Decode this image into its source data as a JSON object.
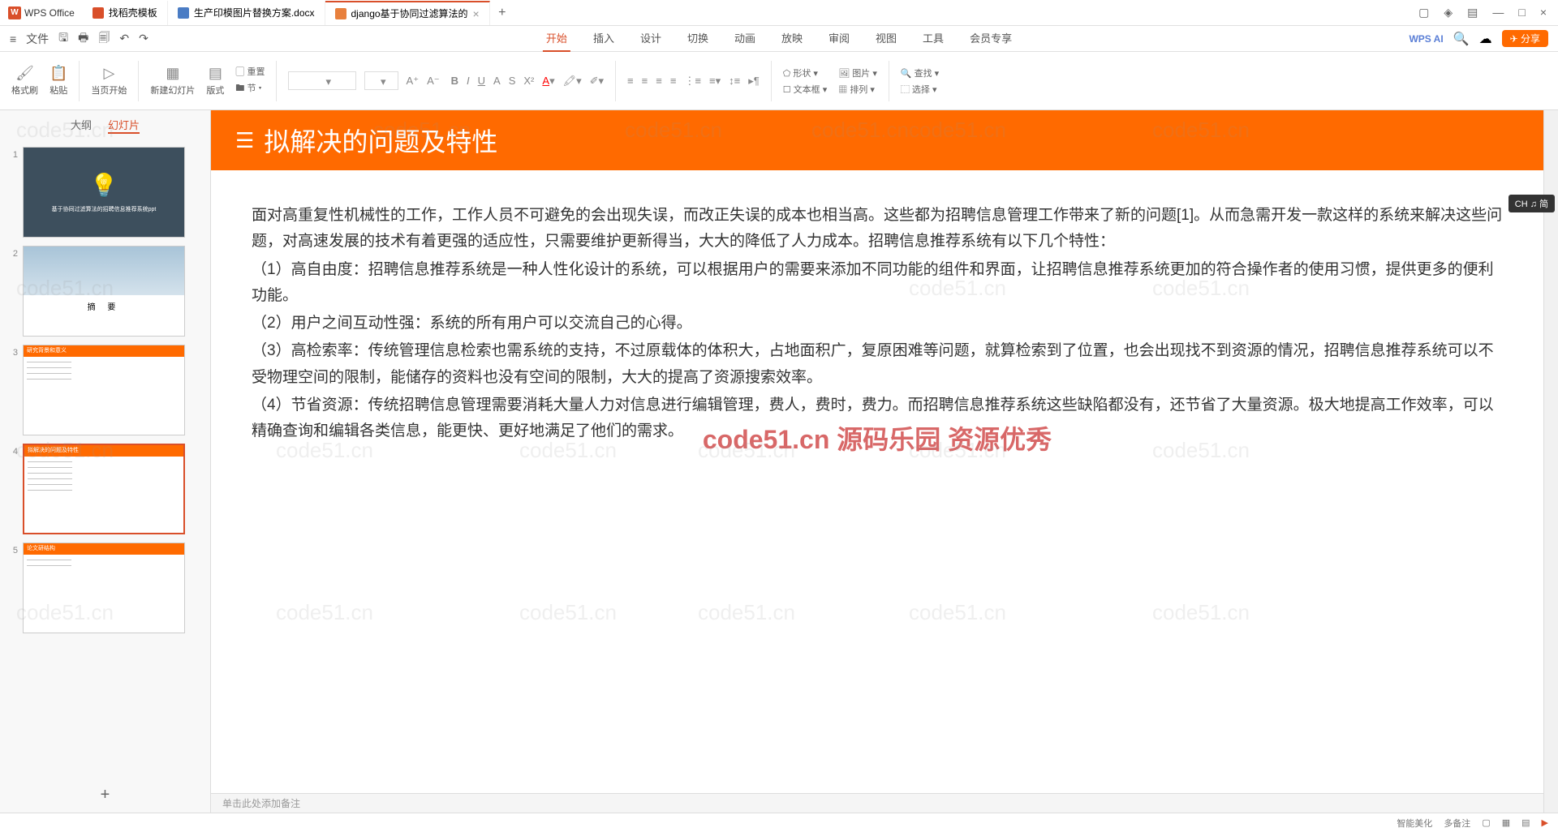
{
  "app": {
    "name": "WPS Office"
  },
  "tabs": [
    {
      "label": "找稻壳模板",
      "icon": "d"
    },
    {
      "label": "生产印模图片替换方案.docx",
      "icon": "w"
    },
    {
      "label": "django基于协同过滤算法的",
      "icon": "p",
      "active": true
    }
  ],
  "file_menu": "文件",
  "main_menu": [
    "开始",
    "插入",
    "设计",
    "切换",
    "动画",
    "放映",
    "审阅",
    "视图",
    "工具",
    "会员专享"
  ],
  "active_menu": "开始",
  "wps_ai": "WPS AI",
  "share": "分享",
  "ribbon": {
    "format_painter": "格式刷",
    "paste": "粘贴",
    "start_current": "当页开始",
    "new_slide": "新建幻灯片",
    "layout": "版式",
    "section": "节",
    "reset": "重置",
    "shape": "形状",
    "picture": "图片",
    "textbox": "文本框",
    "arrange": "排列",
    "find": "查找",
    "select": "选择"
  },
  "sidebar_tabs": {
    "outline": "大纲",
    "slides": "幻灯片"
  },
  "thumbs": [
    {
      "num": "1",
      "type": "dark",
      "title": "基于协同过滤算法的招聘信息推荐系统ppt"
    },
    {
      "num": "2",
      "type": "img",
      "title": "摘    要"
    },
    {
      "num": "3",
      "type": "text",
      "header": "研究背景和意义"
    },
    {
      "num": "4",
      "type": "text",
      "header": "拟解决的问题及特性",
      "selected": true
    },
    {
      "num": "5",
      "type": "text",
      "header": "论文研结构"
    }
  ],
  "slide": {
    "title": "拟解决的问题及特性",
    "body": [
      "面对高重复性机械性的工作，工作人员不可避免的会出现失误，而改正失误的成本也相当高。这些都为招聘信息管理工作带来了新的问题[1]。从而急需开发一款这样的系统来解决这些问题，对高速发展的技术有着更强的适应性，只需要维护更新得当，大大的降低了人力成本。招聘信息推荐系统有以下几个特性：",
      "（1）高自由度：招聘信息推荐系统是一种人性化设计的系统，可以根据用户的需要来添加不同功能的组件和界面，让招聘信息推荐系统更加的符合操作者的使用习惯，提供更多的便利功能。",
      "（2）用户之间互动性强：系统的所有用户可以交流自己的心得。",
      "（3）高检索率：传统管理信息检索也需系统的支持，不过原载体的体积大，占地面积广，复原困难等问题，就算检索到了位置，也会出现找不到资源的情况，招聘信息推荐系统可以不受物理空间的限制，能储存的资料也没有空间的限制，大大的提高了资源搜索效率。",
      "（4）节省资源：传统招聘信息管理需要消耗大量人力对信息进行编辑管理，费人，费时，费力。而招聘信息推荐系统这些缺陷都没有，还节省了大量资源。极大地提高工作效率，可以精确查询和编辑各类信息，能更快、更好地满足了他们的需求。"
    ]
  },
  "notes_placeholder": "单击此处添加备注",
  "watermark": "code51.cn",
  "red_watermark": "code51.cn 源码乐园 资源优秀",
  "float_badge": "CH ♫ 简",
  "status": {
    "smart": "智能美化",
    "more": "多备注"
  }
}
